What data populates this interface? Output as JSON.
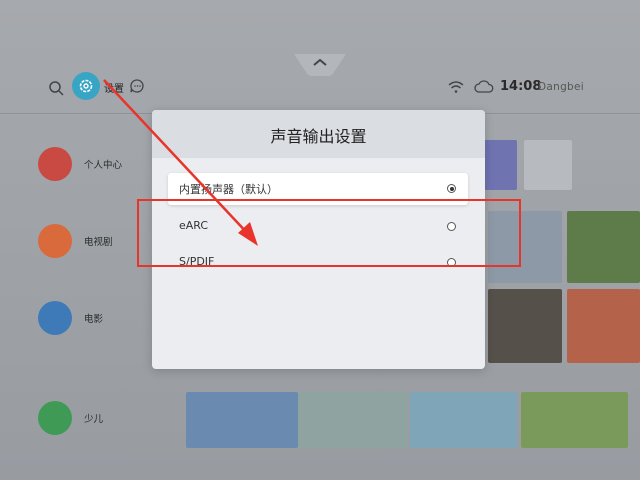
{
  "topbar": {
    "settings_label": "设置",
    "time": "14:08",
    "brand": "Dangbei"
  },
  "categories": [
    {
      "label": "个人中心"
    },
    {
      "label": "电视剧"
    },
    {
      "label": "电影"
    },
    {
      "label": "少儿"
    }
  ],
  "dialog": {
    "title": "声音输出设置",
    "options": [
      {
        "label": "内置扬声器（默认）",
        "selected": true
      },
      {
        "label": "eARC",
        "selected": false
      },
      {
        "label": "S/PDIF",
        "selected": false
      }
    ]
  },
  "colors": {
    "accent": "#39a5c5",
    "annotation": "#e8342a"
  }
}
